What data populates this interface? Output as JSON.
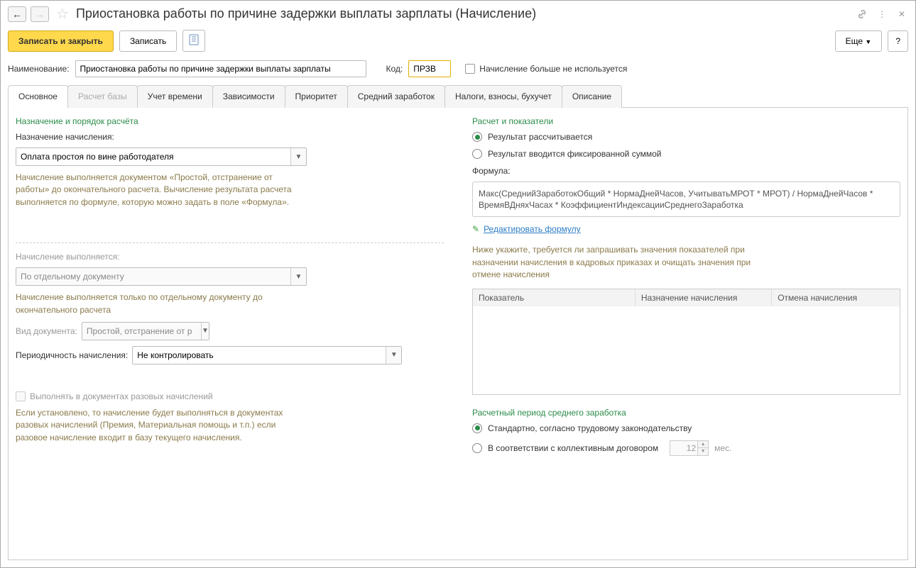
{
  "titlebar": {
    "title": "Приостановка работы по причине задержки выплаты зарплаты (Начисление)"
  },
  "toolbar": {
    "save_close": "Записать и закрыть",
    "save": "Записать",
    "more": "Еще",
    "help": "?"
  },
  "fields": {
    "name_label": "Наименование:",
    "name_value": "Приостановка работы по причине задержки выплаты зарплаты",
    "code_label": "Код:",
    "code_value": "ПРЗВ",
    "not_used_label": "Начисление больше не используется"
  },
  "tabs": [
    "Основное",
    "Расчет базы",
    "Учет времени",
    "Зависимости",
    "Приоритет",
    "Средний заработок",
    "Налоги, взносы, бухучет",
    "Описание"
  ],
  "left": {
    "section1_title": "Назначение и порядок расчёта",
    "assign_label": "Назначение начисления:",
    "assign_value": "Оплата простоя по вине работодателя",
    "assign_help": "Начисление выполняется документом «Простой, отстранение от работы» до окончательного расчета. Вычисление результата расчета выполняется по формуле, которую можно задать в поле «Формула».",
    "exec_label": "Начисление выполняется:",
    "exec_value": "По отдельному документу",
    "exec_help": "Начисление выполняется только по отдельному документу до окончательного расчета",
    "doc_type_label": "Вид документа:",
    "doc_type_value": "Простой, отстранение от р",
    "period_label": "Периодичность начисления:",
    "period_value": "Не контролировать",
    "once_docs_label": "Выполнять в документах разовых начислений",
    "once_docs_help": "Если установлено, то начисление будет выполняться в документах разовых начислений (Премия, Материальная помощь и т.п.) если разовое начисление входит в базу текущего начисления."
  },
  "right": {
    "section_title": "Расчет и показатели",
    "result_calc": "Результат рассчитывается",
    "result_fixed": "Результат вводится фиксированной суммой",
    "formula_label": "Формула:",
    "formula_value": "Макс(СреднийЗаработокОбщий * НормаДнейЧасов, УчитыватьМРОТ * МРОТ) / НормаДнейЧасов * ВремяВДняхЧасах * КоэффициентИндексацииСреднегоЗаработка",
    "edit_formula": "Редактировать формулу",
    "hint": "Ниже укажите, требуется ли запрашивать значения показателей при назначении начисления в кадровых приказах и очищать значения при отмене начисления",
    "col1": "Показатель",
    "col2": "Назначение начисления",
    "col3": "Отмена начисления",
    "period_title": "Расчетный период среднего заработка",
    "period_standard": "Стандартно, согласно трудовому законодательству",
    "period_custom": "В соответствии с коллективным договором",
    "months_value": "12",
    "months_unit": "мес."
  }
}
